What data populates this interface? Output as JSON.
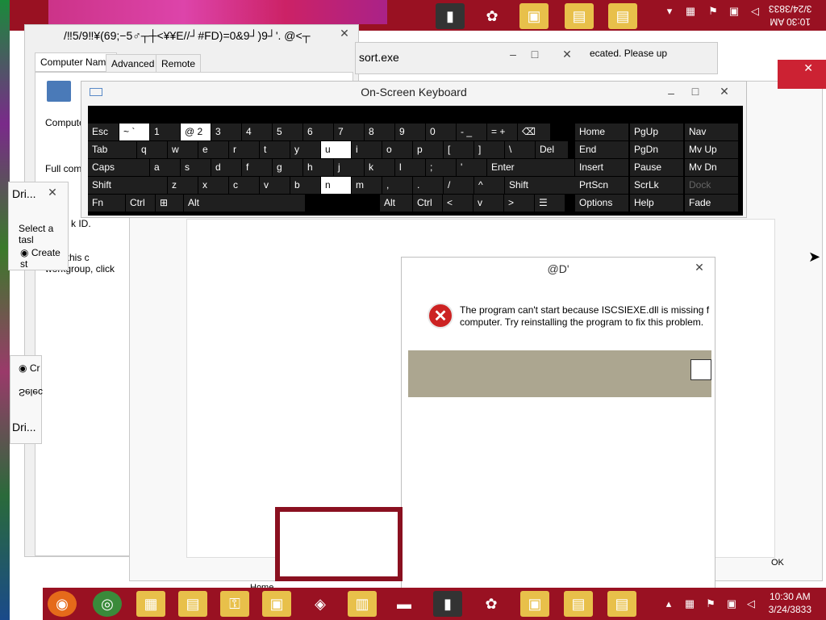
{
  "system_properties": {
    "window_title_garbled": "Computer Name",
    "garbled_text": "/‼5/9‼¥(69;−5♂┬┼<¥¥E//┘#FD)=0&9┘)9┘'.  @<┬",
    "tabs": [
      "Computer Name",
      "Advanced",
      "Remote"
    ],
    "computer_label": "Computer",
    "full_comp_label": "Full comp",
    "name_this_text": "ame this c",
    "workgroup_text": "workgroup, click"
  },
  "sort_window": {
    "title_partial": "sort.exe",
    "text_partial": "ecated. Please up"
  },
  "drive_window": {
    "title": "Dri...",
    "select_task": "Select a tasl",
    "create_option": "Create st",
    "disk_id": "k ID."
  },
  "drive_window2": {
    "option": "Cr",
    "select": "Selec",
    "title": "Dri..."
  },
  "osk": {
    "title": "On-Screen Keyboard",
    "rows": [
      [
        "Esc",
        "~ `",
        "1",
        "@ 2",
        "3",
        "4",
        "5",
        "6",
        "7",
        "8",
        "9",
        "0",
        "- _",
        "= +",
        "⌫"
      ],
      [
        "Tab",
        "q",
        "w",
        "e",
        "r",
        "t",
        "y",
        "u",
        "i",
        "o",
        "p",
        "[",
        "]",
        "\\",
        "Del"
      ],
      [
        "Caps",
        "a",
        "s",
        "d",
        "f",
        "g",
        "h",
        "j",
        "k",
        "l",
        ";",
        "'",
        "Enter"
      ],
      [
        "Shift",
        "z",
        "x",
        "c",
        "v",
        "b",
        "n",
        "m",
        ",",
        ".",
        "/",
        "^",
        "Shift"
      ],
      [
        "Fn",
        "Ctrl",
        "⊞",
        "Alt",
        "Alt",
        "Ctrl",
        "<",
        "v",
        ">",
        "☰"
      ]
    ],
    "nav_keys": [
      [
        "Home",
        "PgUp",
        "Nav"
      ],
      [
        "End",
        "PgDn",
        "Mv Up"
      ],
      [
        "Insert",
        "Pause",
        "Mv Dn"
      ],
      [
        "PrtScn",
        "ScrLk",
        "Dock"
      ],
      [
        "Options",
        "Help",
        "Fade"
      ]
    ]
  },
  "error_dialog": {
    "title": "@D'",
    "message_line1": "The program can't start because ISCSIEXE.dll is missing from",
    "message_line2": "computer. Try reinstalling the program to fix this problem."
  },
  "ok_partial": "OK",
  "home_partial": "Home",
  "taskbar": {
    "time": "10:30 AM",
    "date": "3/24/3833",
    "time_top": "10:30 AM",
    "date_top": "3/24/3833"
  },
  "colors": {
    "taskbar": "#991122",
    "osk_bg": "#000000",
    "error_band": "#aca690"
  }
}
